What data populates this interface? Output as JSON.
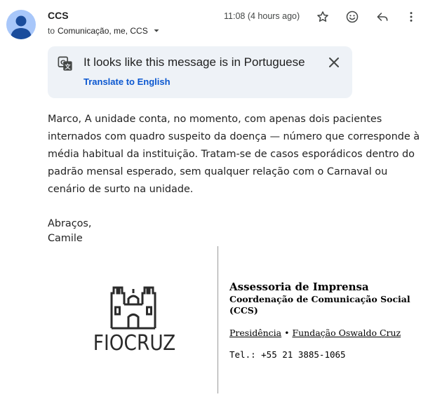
{
  "header": {
    "sender": "CCS",
    "to_label": "to",
    "recipients": "Comunicação, me, CCS",
    "time": "11:08 (4 hours ago)",
    "icons": [
      "star-icon",
      "emoji-icon",
      "reply-icon",
      "more-vert-icon"
    ]
  },
  "translate": {
    "message": "It looks like this message is in Portuguese",
    "link": "Translate to English"
  },
  "email": {
    "body": "Marco, A unidade conta, no momento, com apenas dois pacientes internados com quadro suspeito da doença — número que corresponde à média habitual da instituição. Tratam-se de casos esporádicos dentro do padrão mensal esperado, sem qualquer relação com o Carnaval ou cenário de surto na unidade.",
    "closing": "Abraços,",
    "name": "Camile"
  },
  "signature": {
    "logo_text": "FIOCRUZ",
    "title": "Assessoria de Imprensa",
    "department": "Coordenação de Comunicação Social (CCS)",
    "link1": "Presidência",
    "separator": "•",
    "link2": "Fundação Oswaldo Cruz",
    "phone": "Tel.: +55 21 3885-1065"
  },
  "colors": {
    "link": "#0b57d0",
    "card_bg": "#eef2f7",
    "avatar_bg": "#a8c7fa",
    "avatar_fg": "#1a4c9c"
  }
}
